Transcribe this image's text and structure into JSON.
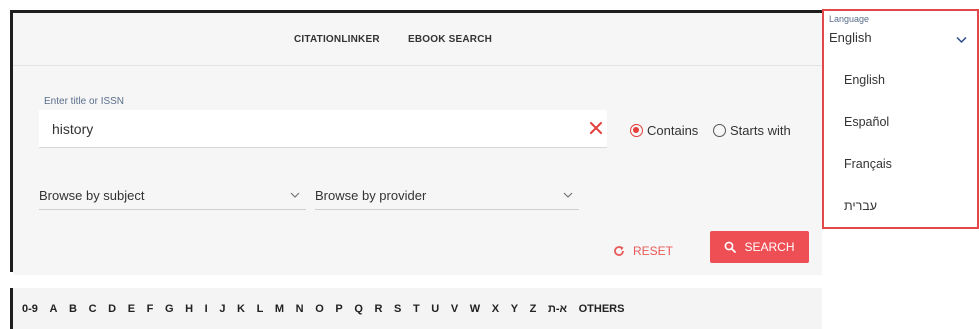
{
  "nav": {
    "citation_linker": "CITATIONLINKER",
    "ebook_search": "EBOOK SEARCH"
  },
  "search": {
    "label": "Enter title or ISSN",
    "value": "history",
    "clear_icon": "close-icon",
    "options": {
      "contains": "Contains",
      "starts_with": "Starts with",
      "selected": "Contains"
    }
  },
  "browse": {
    "subject": "Browse by subject",
    "provider": "Browse by provider"
  },
  "actions": {
    "reset": "RESET",
    "search": "SEARCH"
  },
  "alphabet": [
    "0-9",
    "A",
    "B",
    "C",
    "D",
    "E",
    "F",
    "G",
    "H",
    "I",
    "J",
    "K",
    "L",
    "M",
    "N",
    "O",
    "P",
    "Q",
    "R",
    "S",
    "T",
    "U",
    "V",
    "W",
    "X",
    "Y",
    "Z",
    "א-ת",
    "OTHERS"
  ],
  "language": {
    "label": "Language",
    "selected": "English",
    "options": [
      "English",
      "Español",
      "Français",
      "עברית"
    ]
  },
  "colors": {
    "accent": "#ee4f55",
    "dropdown_border": "#e34848",
    "label": "#5a6e8c"
  }
}
